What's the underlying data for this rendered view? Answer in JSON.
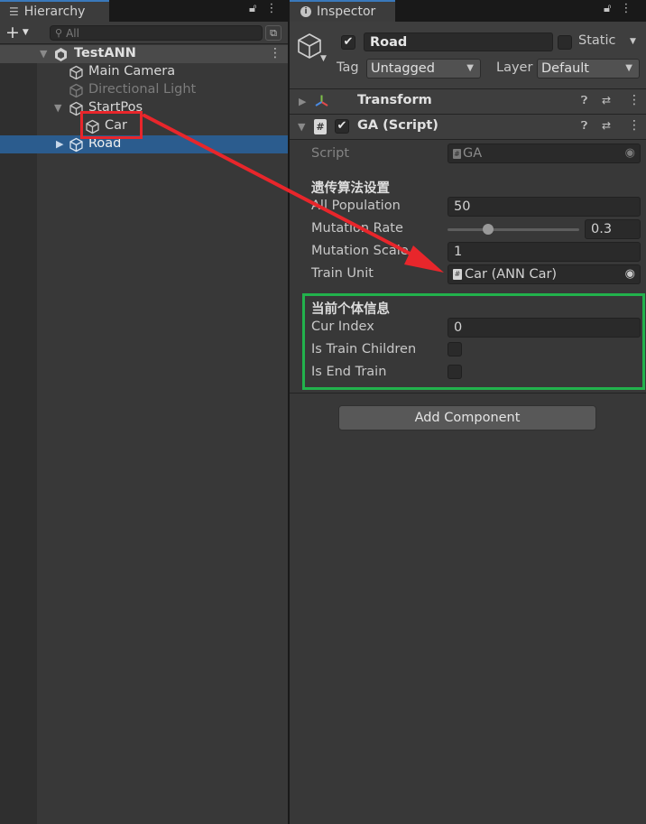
{
  "hierarchy": {
    "tab_label": "Hierarchy",
    "search_placeholder": "All",
    "scene_name": "TestANN",
    "items": [
      {
        "label": "Main Camera"
      },
      {
        "label": "Directional Light"
      },
      {
        "label": "StartPos"
      },
      {
        "label": "Car"
      },
      {
        "label": "Road"
      }
    ]
  },
  "inspector": {
    "tab_label": "Inspector",
    "object_name": "Road",
    "static_label": "Static",
    "tag_label": "Tag",
    "tag_value": "Untagged",
    "layer_label": "Layer",
    "layer_value": "Default",
    "components": {
      "transform": {
        "title": "Transform"
      },
      "ga": {
        "title": "GA (Script)",
        "script_label": "Script",
        "script_value": "GA",
        "section1": "遗传算法设置",
        "fields": [
          {
            "label": "All Population",
            "value": "50"
          },
          {
            "label": "Mutation Rate",
            "value": "0.3",
            "slider_fraction": 0.3
          },
          {
            "label": "Mutation Scale",
            "value": "1"
          },
          {
            "label": "Train Unit",
            "value": "Car (ANN Car)"
          }
        ],
        "section2": "当前个体信息",
        "info": [
          {
            "label": "Cur Index",
            "value": "0"
          },
          {
            "label": "Is Train Children",
            "checked": false
          },
          {
            "label": "Is End Train",
            "checked": false
          }
        ]
      }
    },
    "add_component_label": "Add Component"
  },
  "annotations": {
    "highlight_red": "#e8262b",
    "highlight_green": "#22b24c"
  }
}
